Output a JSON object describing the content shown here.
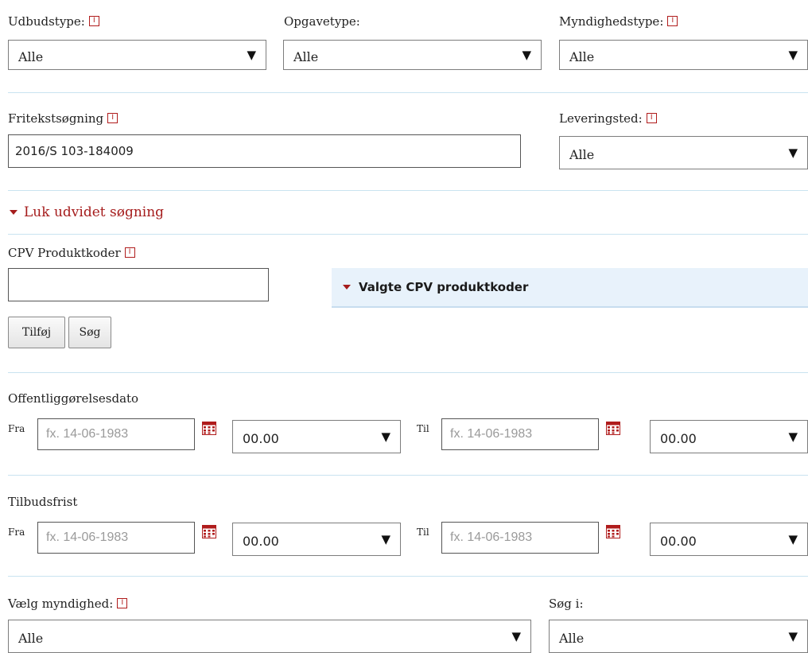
{
  "udbudstype": {
    "label": "Udbudstype:",
    "value": "Alle"
  },
  "opgavetype": {
    "label": "Opgavetype:",
    "value": "Alle"
  },
  "myndighedstype": {
    "label": "Myndighedstype:",
    "value": "Alle"
  },
  "fritekst": {
    "label": "Fritekstsøgning",
    "value": "2016/S 103-184009"
  },
  "leveringsted": {
    "label": "Leveringsted:",
    "value": "Alle"
  },
  "toggle_advanced": "Luk udvidet søgning",
  "cpv": {
    "label": "CPV Produktkoder",
    "value": "",
    "selected_header": "Valgte CPV produktkoder",
    "add_button": "Tilføj",
    "search_button": "Søg"
  },
  "offentliggorelse": {
    "label": "Offentliggørelsesdato",
    "from_label": "Fra",
    "to_label": "Til",
    "from_placeholder": "fx. 14-06-1983",
    "to_placeholder": "fx. 14-06-1983",
    "from_time": "00.00",
    "to_time": "00.00"
  },
  "tilbudsfrist": {
    "label": "Tilbudsfrist",
    "from_label": "Fra",
    "to_label": "Til",
    "from_placeholder": "fx. 14-06-1983",
    "to_placeholder": "fx. 14-06-1983",
    "from_time": "00.00",
    "to_time": "00.00"
  },
  "myndighed": {
    "label": "Vælg myndighed:",
    "value": "Alle"
  },
  "soeg_i": {
    "label": "Søg i:",
    "value": "Alle"
  },
  "icons": {
    "info": "I",
    "dropdown_arrow": "▼"
  },
  "colors": {
    "accent_red": "#a51c1c",
    "divider": "#c9e3f0",
    "panel_bg": "#e8f2fb"
  }
}
